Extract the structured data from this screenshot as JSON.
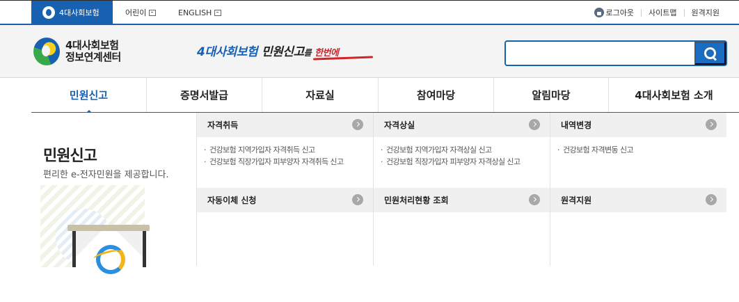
{
  "topbar": {
    "brand_tab": "4대사회보험",
    "link_kids": "어린이",
    "link_english": "ENGLISH",
    "logout": "로그아웃",
    "sitemap": "사이트맵",
    "remote_support": "원격지원"
  },
  "header": {
    "logo_line1": "4대사회보험",
    "logo_line2": "정보연계센터",
    "slogan_part1": "4대사회보험",
    "slogan_part2": "민원신고",
    "slogan_part3": "를",
    "slogan_part4": "한번에",
    "search_placeholder": ""
  },
  "nav": {
    "items": [
      {
        "label": "민원신고"
      },
      {
        "label": "증명서발급"
      },
      {
        "label": "자료실"
      },
      {
        "label": "참여마당"
      },
      {
        "label": "알림마당"
      },
      {
        "label": "4대사회보험 소개"
      }
    ]
  },
  "left_panel": {
    "title": "민원신고",
    "subtitle": "편리한 e-전자민원을 제공합니다."
  },
  "submenu": {
    "categories": [
      {
        "label": "자격취득",
        "items": [
          "건강보험 지역가입자 자격취득 신고",
          "건강보험 직장가입자 피부양자 자격취득 신고"
        ]
      },
      {
        "label": "자격상실",
        "items": [
          "건강보험 지역가입자 자격상실 신고",
          "건강보험 직장가입자 피부양자 자격상실 신고"
        ]
      },
      {
        "label": "내역변경",
        "items": [
          "건강보험 자격변동 신고"
        ]
      },
      {
        "label": "자동이체 신청",
        "items": []
      },
      {
        "label": "민원처리현황 조회",
        "items": []
      },
      {
        "label": "원격지원",
        "items": []
      }
    ]
  },
  "colors": {
    "brand_blue": "#1761b0",
    "accent_red": "#d0242a",
    "category_bg": "#f0f0f0"
  }
}
